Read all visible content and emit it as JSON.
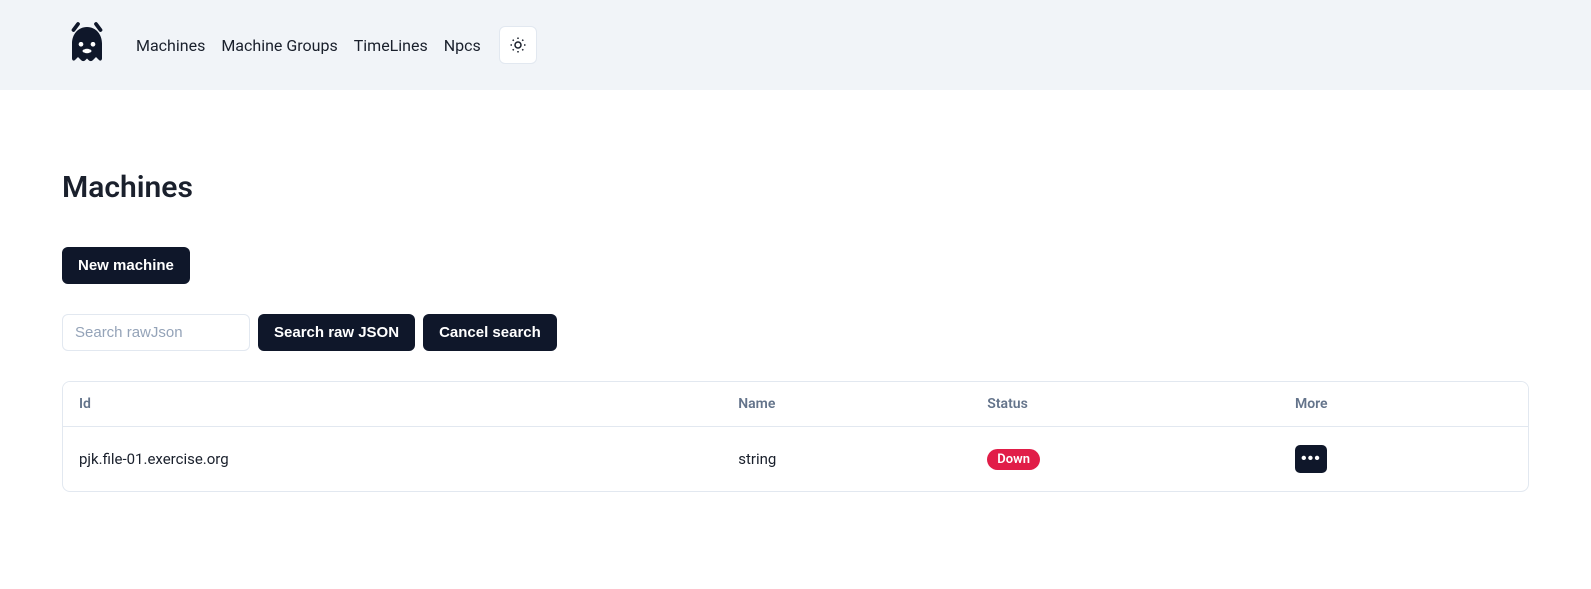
{
  "nav": {
    "items": [
      {
        "label": "Machines"
      },
      {
        "label": "Machine Groups"
      },
      {
        "label": "TimeLines"
      },
      {
        "label": "Npcs"
      }
    ]
  },
  "page": {
    "title": "Machines"
  },
  "actions": {
    "new_machine": "New machine",
    "search_raw_json": "Search raw JSON",
    "cancel_search": "Cancel search"
  },
  "search": {
    "placeholder": "Search rawJson",
    "value": ""
  },
  "table": {
    "headers": {
      "id": "Id",
      "name": "Name",
      "status": "Status",
      "more": "More"
    },
    "rows": [
      {
        "id": "pjk.file-01.exercise.org",
        "name": "string",
        "status": "Down"
      }
    ]
  }
}
